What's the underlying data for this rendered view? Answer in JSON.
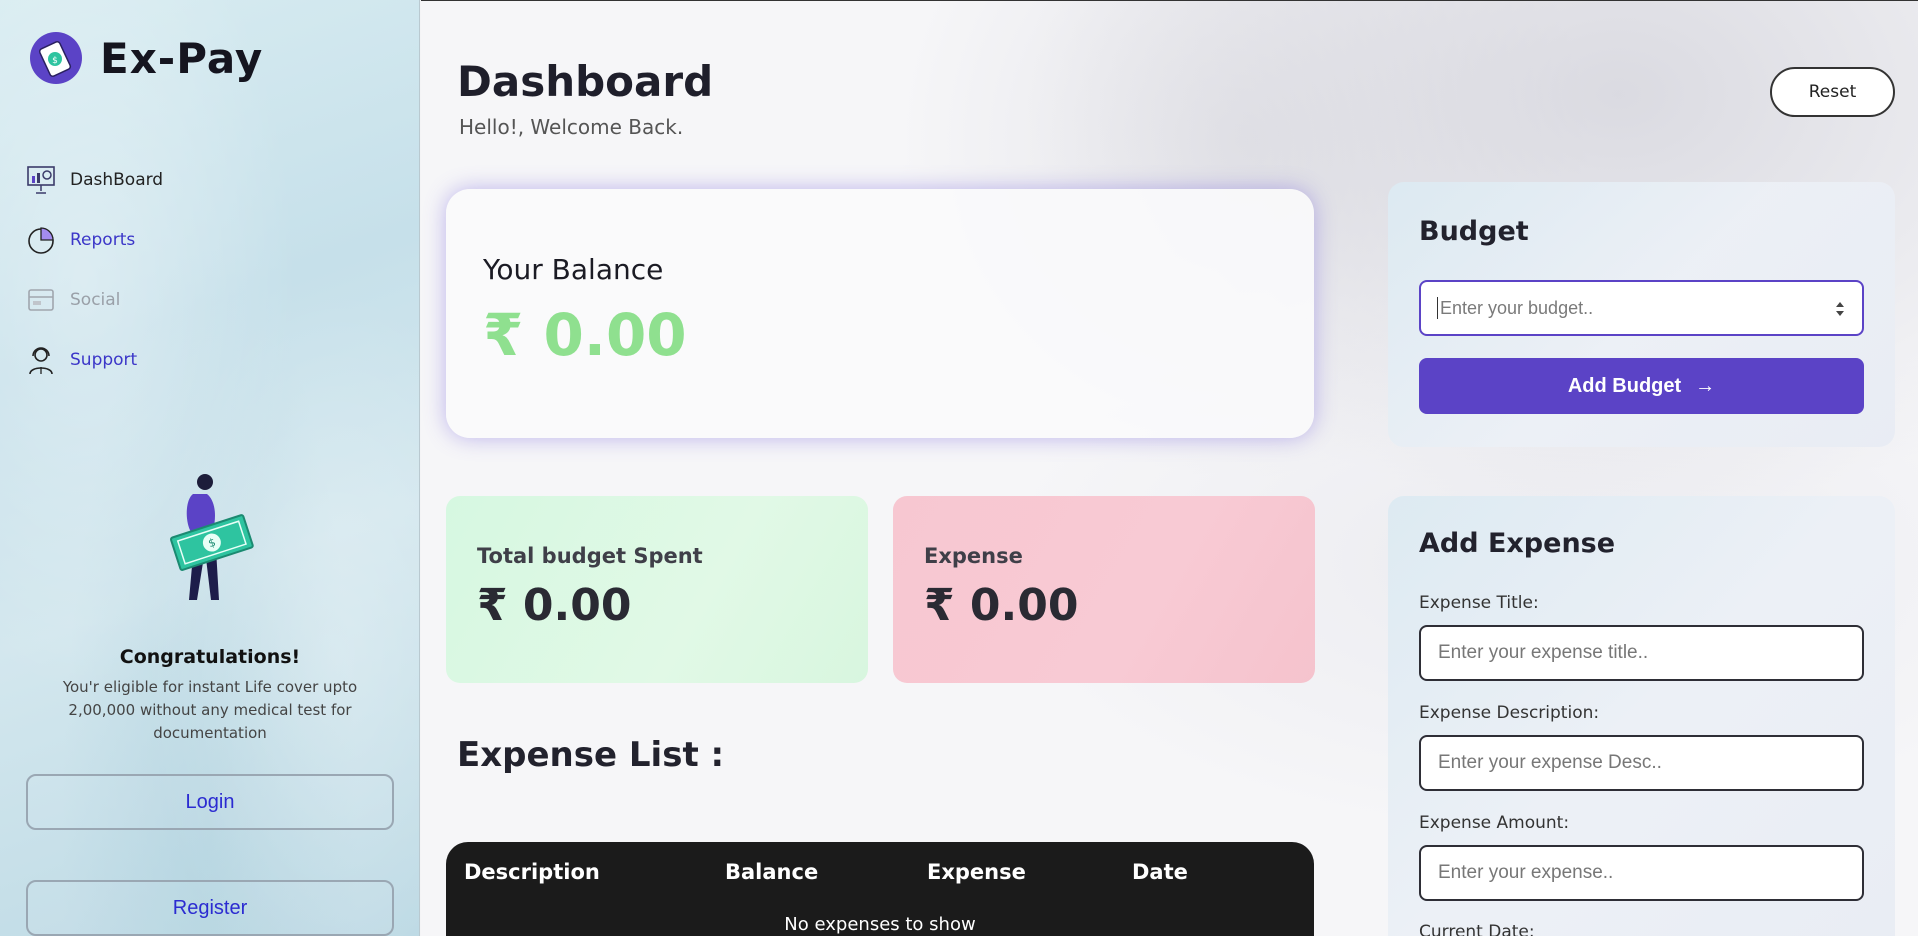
{
  "brand": {
    "name": "Ex-Pay",
    "accent": "#5b43c6"
  },
  "sidebar": {
    "items": [
      {
        "label": "DashBoard",
        "icon": "presentation-chart-icon"
      },
      {
        "label": "Reports",
        "icon": "pie-chart-icon"
      },
      {
        "label": "Social",
        "icon": "card-icon"
      },
      {
        "label": "Support",
        "icon": "support-agent-icon"
      }
    ],
    "promo": {
      "title": "Congratulations!",
      "text": "You'r eligible for instant Life cover upto 2,00,000 without any medical test for documentation"
    },
    "login_label": "Login",
    "register_label": "Register"
  },
  "header": {
    "title": "Dashboard",
    "subtitle": "Hello!, Welcome Back.",
    "reset_label": "Reset"
  },
  "balance": {
    "label": "Your Balance",
    "value": "₹ 0.00",
    "color": "#8fe08f"
  },
  "stats": {
    "budget_spent": {
      "label": "Total budget Spent",
      "value": "₹ 0.00",
      "color": "#d6f8e1"
    },
    "expense": {
      "label": "Expense",
      "value": "₹ 0.00",
      "color": "#f7c7d1"
    }
  },
  "expense_list": {
    "title": "Expense List :",
    "columns": [
      "Description",
      "Balance",
      "Expense",
      "Date"
    ],
    "empty_text": "No expenses to show"
  },
  "budget_panel": {
    "title": "Budget",
    "input_placeholder": "Enter your budget..",
    "button_label": "Add Budget"
  },
  "expense_panel": {
    "title": "Add Expense",
    "fields": [
      {
        "label": "Expense Title:",
        "placeholder": "Enter your expense title.."
      },
      {
        "label": "Expense Description:",
        "placeholder": "Enter your expense Desc.."
      },
      {
        "label": "Expense Amount:",
        "placeholder": "Enter your expense.."
      }
    ],
    "date_label": "Current Date:"
  }
}
